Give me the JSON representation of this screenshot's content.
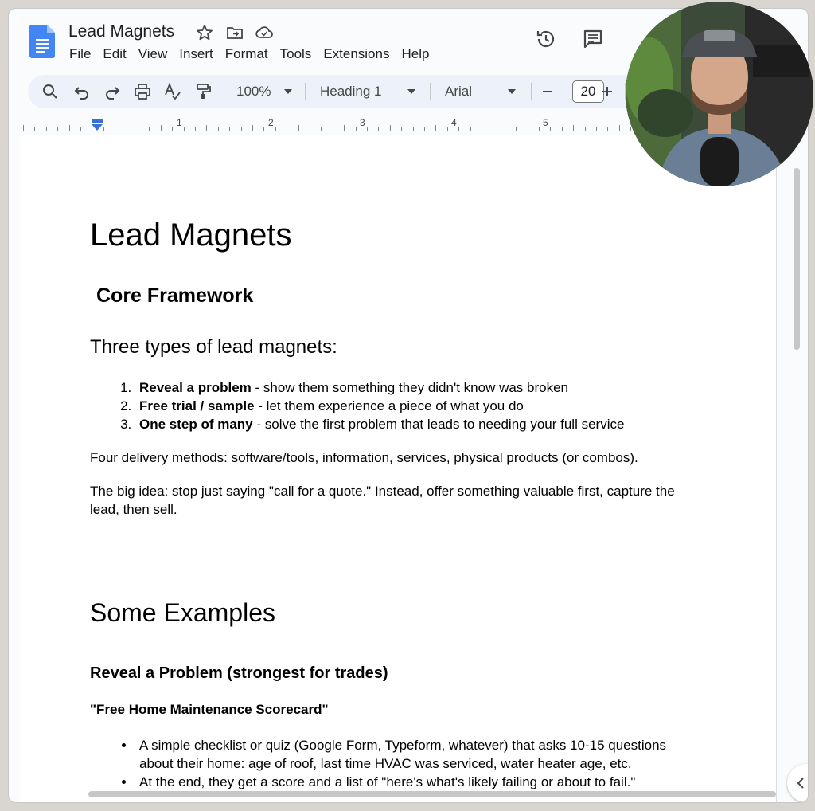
{
  "doc_title": "Lead Magnets",
  "menu": [
    "File",
    "Edit",
    "View",
    "Insert",
    "Format",
    "Tools",
    "Extensions",
    "Help"
  ],
  "toolbar": {
    "zoom": "100%",
    "style": "Heading 1",
    "font": "Arial",
    "font_size": "20"
  },
  "ruler_numbers": [
    "1",
    "2",
    "3",
    "4",
    "5"
  ],
  "content": {
    "title": "Lead Magnets",
    "core": "Core Framework",
    "three": "Three types of lead magnets:",
    "types": [
      {
        "bold": "Reveal a problem",
        "rest": " - show them something they didn't know was broken"
      },
      {
        "bold": "Free trial / sample",
        "rest": " - let them experience a piece of what you do"
      },
      {
        "bold": "One step of many",
        "rest": " - solve the first problem that leads to needing your full service"
      }
    ],
    "p1": "Four delivery methods: software/tools, information, services, physical products (or combos).",
    "p2": "The big idea: stop just saying \"call for a quote.\" Instead, offer something valuable first, capture the lead, then sell.",
    "examples": "Some Examples",
    "reveal": "Reveal a Problem (strongest for trades)",
    "scorecard": "\"Free Home Maintenance Scorecard\"",
    "bullets": [
      "A simple checklist or quiz (Google Form, Typeform, whatever) that asks 10-15 questions about their home: age of roof, last time HVAC was serviced, water heater age, etc.",
      "At the end, they get a score and a list of \"here's what's likely failing or about to fail.\""
    ]
  },
  "colors": {
    "docs_blue": "#4285f4",
    "toolbar_bg": "#edf2fa",
    "page_bg": "#ffffff",
    "canvas_bg": "#f9fbfd"
  }
}
